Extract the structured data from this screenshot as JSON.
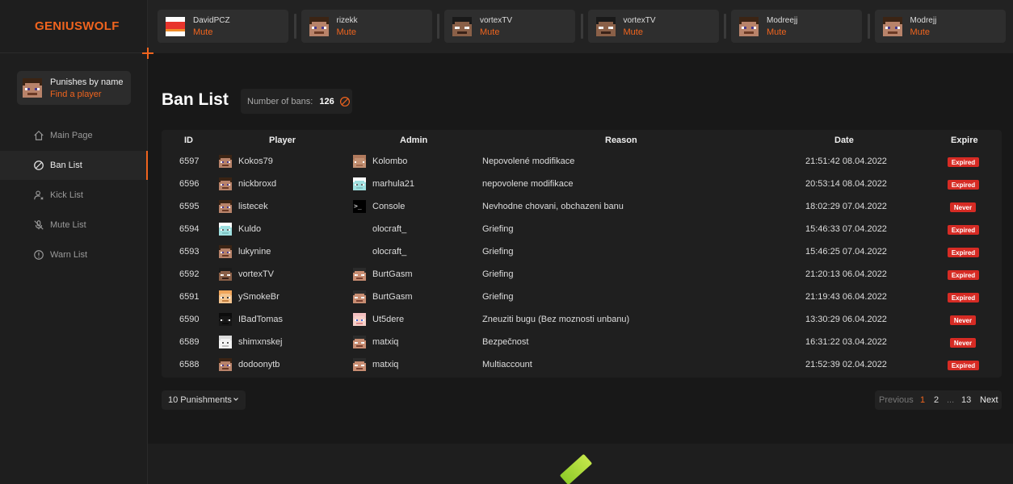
{
  "brand": "GENIUSWOLF",
  "colors": {
    "accent": "#f0641e",
    "badge": "#d62b24"
  },
  "search": {
    "title": "Punishes by name",
    "link": "Find a player"
  },
  "nav": [
    {
      "label": "Main Page",
      "icon": "home-icon"
    },
    {
      "label": "Ban List",
      "icon": "ban-icon",
      "active": true
    },
    {
      "label": "Kick List",
      "icon": "kick-icon"
    },
    {
      "label": "Mute List",
      "icon": "mute-icon"
    },
    {
      "label": "Warn List",
      "icon": "warn-icon"
    }
  ],
  "topbar": [
    {
      "name": "DavidPCZ",
      "action": "Mute",
      "skin": "red"
    },
    {
      "name": "rizekk",
      "action": "Mute",
      "skin": "steve"
    },
    {
      "name": "vortexTV",
      "action": "Mute",
      "skin": "dark"
    },
    {
      "name": "vortexTV",
      "action": "Mute",
      "skin": "dark"
    },
    {
      "name": "Modreejj",
      "action": "Mute",
      "skin": "steve"
    },
    {
      "name": "Modrejj",
      "action": "Mute",
      "skin": "steve"
    }
  ],
  "page": {
    "title": "Ban List",
    "count_label": "Number of bans:",
    "count": "126"
  },
  "table": {
    "headers": [
      "ID",
      "Player",
      "Admin",
      "Reason",
      "Date",
      "Expire"
    ],
    "rows": [
      {
        "id": "6597",
        "player": "Kokos79",
        "player_skin": "steve",
        "admin": "Kolombo",
        "admin_skin": "tan",
        "reason": "Nepovolené modifikace",
        "date": "21:51:42 08.04.2022",
        "expire": "Expired"
      },
      {
        "id": "6596",
        "player": "nickbroxd",
        "player_skin": "steve",
        "admin": "marhula21",
        "admin_skin": "cyan",
        "reason": "nepovolene modifikace",
        "date": "20:53:14 08.04.2022",
        "expire": "Expired"
      },
      {
        "id": "6595",
        "player": "listecek",
        "player_skin": "steve",
        "admin": "Console",
        "admin_skin": "console",
        "reason": "Nevhodne chovani, obchazeni banu",
        "date": "18:02:29 07.04.2022",
        "expire": "Never"
      },
      {
        "id": "6594",
        "player": "Kuldo",
        "player_skin": "cyan",
        "admin": "olocraft_",
        "admin_skin": "none",
        "reason": "Griefing",
        "date": "15:46:33 07.04.2022",
        "expire": "Expired"
      },
      {
        "id": "6593",
        "player": "lukynine",
        "player_skin": "steve",
        "admin": "olocraft_",
        "admin_skin": "none",
        "reason": "Griefing",
        "date": "15:46:25 07.04.2022",
        "expire": "Expired"
      },
      {
        "id": "6592",
        "player": "vortexTV",
        "player_skin": "dark",
        "admin": "BurtGasm",
        "admin_skin": "burt",
        "reason": "Griefing",
        "date": "21:20:13 06.04.2022",
        "expire": "Expired"
      },
      {
        "id": "6591",
        "player": "ySmokeBr",
        "player_skin": "orange",
        "admin": "BurtGasm",
        "admin_skin": "burt",
        "reason": "Griefing",
        "date": "21:19:43 06.04.2022",
        "expire": "Expired"
      },
      {
        "id": "6590",
        "player": "IBadTomas",
        "player_skin": "black",
        "admin": "Ut5dere",
        "admin_skin": "pink",
        "reason": "Zneuziti bugu (Bez moznosti unbanu)",
        "date": "13:30:29 06.04.2022",
        "expire": "Never"
      },
      {
        "id": "6589",
        "player": "shimxnskej",
        "player_skin": "white",
        "admin": "matxiq",
        "admin_skin": "burt",
        "reason": "Bezpečnost",
        "date": "16:31:22 03.04.2022",
        "expire": "Never"
      },
      {
        "id": "6588",
        "player": "dodoonytb",
        "player_skin": "steve",
        "admin": "matxiq",
        "admin_skin": "burt",
        "reason": "Multiaccount",
        "date": "21:52:39 02.04.2022",
        "expire": "Expired"
      }
    ]
  },
  "per_page": "10 Punishments",
  "pagination": {
    "prev": "Previous",
    "pages": [
      "1",
      "2",
      "...",
      "13"
    ],
    "current": "1",
    "next": "Next"
  },
  "console_glyph": ">_"
}
